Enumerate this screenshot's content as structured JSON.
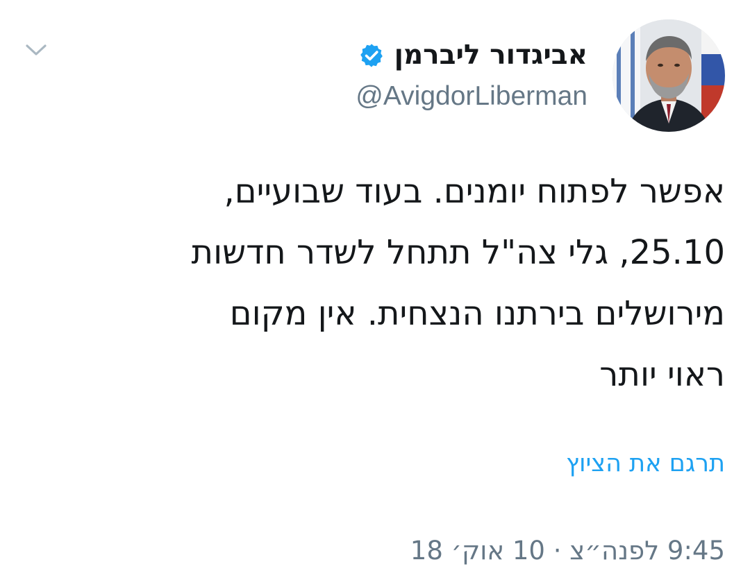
{
  "tweet": {
    "author": {
      "display_name": "אביגדור ליברמן",
      "handle": "@AvigdorLiberman",
      "verified": true,
      "avatar_icon": "profile-photo"
    },
    "menu_icon": "chevron-down-icon",
    "text_lines": [
      "אפשר לפתוח יומנים. בעוד שבועיים,",
      "25.10, גלי צה\"ל תתחל לשדר חדשות",
      "מירושלים בירתנו הנצחית. אין מקום",
      "ראוי יותר"
    ],
    "translate_label": "תרגם את הציוץ",
    "timestamp": "9:45 לפנה״צ · 10 אוק׳ 18"
  },
  "colors": {
    "link": "#1da1f2",
    "verified": "#1da1f2",
    "muted": "#657786",
    "text": "#14171a",
    "background": "#ffffff"
  }
}
